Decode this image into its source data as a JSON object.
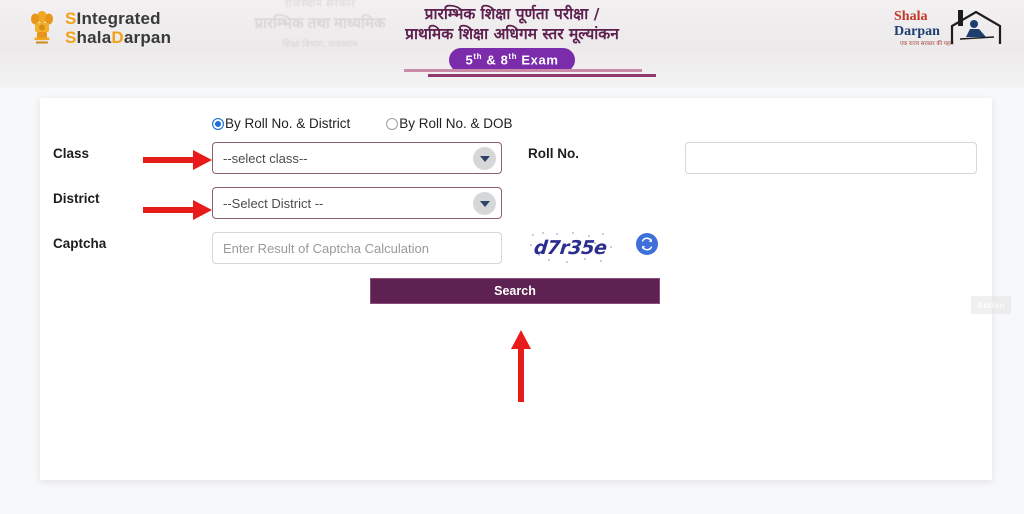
{
  "header": {
    "left_logo": {
      "emblem_icon": "ashoka-emblem-icon",
      "line1": "Integrated",
      "line2_a": "S",
      "line2_b": "hala",
      "line2_c": "D",
      "line2_d": "arpan"
    },
    "title_line1": "प्रारम्भिक शिक्षा पूर्णता परीक्षा /",
    "title_line2": "प्राथमिक शिक्षा अधिगम स्तर मूल्यांकन",
    "exam_badge": "5th & 8th Exam",
    "exam_badge_parts": {
      "n1": "5",
      "sup1": "th",
      "amp": "&",
      "n2": "8",
      "sup2": "th",
      "word": "Exam"
    },
    "watermark": {
      "line1": "राजस्थान सरकार",
      "line2": "प्रारम्भिक तथा माध्यमिक",
      "line3": "शिक्षा विभाग, राजस्थान"
    },
    "right_logo": {
      "shala": "Shala",
      "darpan": "Darpan",
      "subtitle": "एक राज्य सरकार की पहल",
      "house_icon": "house-icon"
    }
  },
  "form": {
    "radio_options": [
      {
        "label": "By Roll No. & District",
        "selected": true
      },
      {
        "label": "By Roll No. & DOB",
        "selected": false
      }
    ],
    "class_label": "Class",
    "class_value": "--select class--",
    "district_label": "District",
    "district_value": "--Select District --",
    "captcha_label": "Captcha",
    "captcha_placeholder": "Enter Result of Captcha Calculation",
    "captcha_value": "",
    "captcha_image_text": "d7r35e",
    "refresh_icon": "refresh-icon",
    "roll_label": "Roll No.",
    "roll_value": "",
    "roll_placeholder": "",
    "search_label": "Search",
    "ghost_label": "Action"
  },
  "colors": {
    "accent_purple": "#5d2152",
    "badge_purple": "#7b2cab",
    "title_maroon": "#5c1f4e",
    "radio_blue": "#1673d1",
    "captcha_blue": "#2b2d8f",
    "refresh_blue": "#3f6fd8",
    "arrow_red": "#e81b1b",
    "select_border": "#8d5f77",
    "logo_gold": "#f2a219"
  }
}
